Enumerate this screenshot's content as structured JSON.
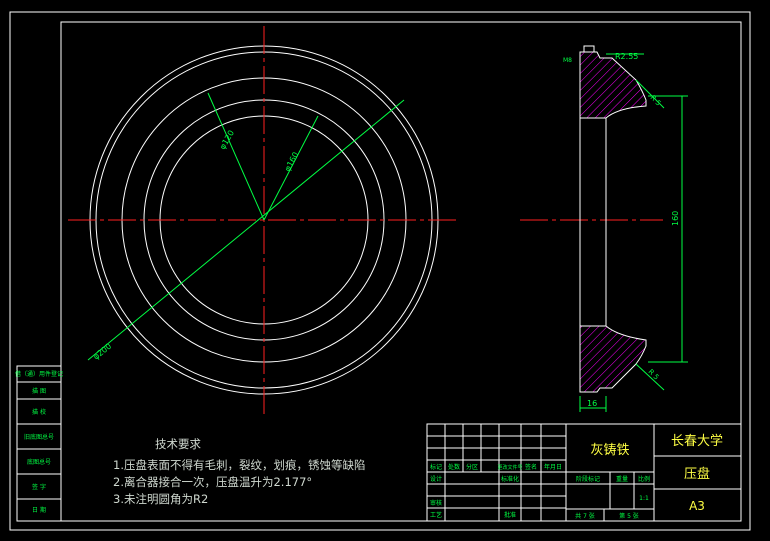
{
  "drawing": {
    "colors": {
      "background": "#000000",
      "outline": "#ffffff",
      "centerline": "#ff2020",
      "dimension": "#00ff44",
      "hatch": "#ff00ff",
      "titleblock_text": "#00ff44",
      "titleblock_accent": "#ffff44"
    },
    "front_view": {
      "dim_outer": "φ200",
      "dim_mid": "φ120",
      "dim_inner": "φ160"
    },
    "section_view": {
      "dim_top_radius": "R2.55",
      "dim_top_label": "M8",
      "dim_r5_top": "R 5",
      "dim_height": "160",
      "dim_r5_bottom": "R 5",
      "dim_thickness": "16"
    },
    "tech_requirements": {
      "title": "技术要求",
      "items": [
        "1.压盘表面不得有毛刺，裂纹，划痕，锈蚀等缺陷",
        "2.离合器接合一次，压盘温升为2.177°",
        "3.未注明圆角为R2"
      ]
    },
    "left_strip": [
      "借（通）用件登记",
      "描 图",
      "描 校",
      "旧底图总号",
      "底图总号",
      "签 字",
      "日 期"
    ],
    "title_block": {
      "material": "灰铸铁",
      "school": "长春大学",
      "part_name": "压盘",
      "sheet_size": "A3",
      "row_headers": [
        "标记",
        "处数",
        "分区",
        "更改文件号",
        "签名",
        "年月日"
      ],
      "design": "设计",
      "standardize": "标准化",
      "review": "审核",
      "craft": "工艺",
      "approve": "批准",
      "stage_label": "阶段标记",
      "weight_label": "重量",
      "scale_label": "比例",
      "scale_value": "1:1",
      "sheets_total": "共 7 张",
      "sheet_num": "第 5 张"
    }
  }
}
